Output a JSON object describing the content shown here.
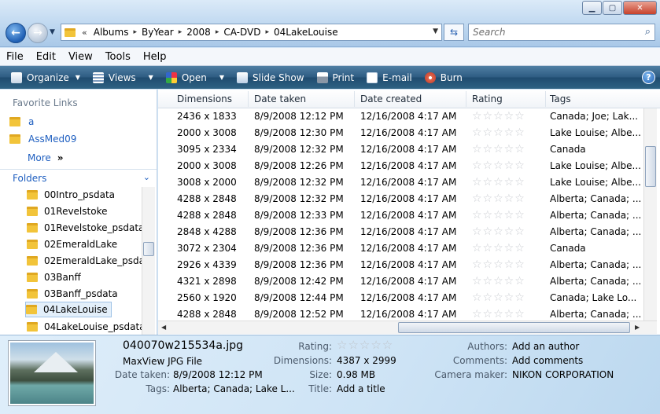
{
  "window": {
    "minimize_glyph": "▁",
    "maximize_glyph": "▢",
    "close_glyph": "✕"
  },
  "address": {
    "chevron": "«",
    "crumbs": [
      "Albums",
      "ByYear",
      "2008",
      "CA-DVD",
      "04LakeLouise"
    ]
  },
  "search": {
    "placeholder": "Search"
  },
  "menu": [
    "File",
    "Edit",
    "View",
    "Tools",
    "Help"
  ],
  "toolbar": {
    "organize": "Organize",
    "views": "Views",
    "open": "Open",
    "slideshow": "Slide Show",
    "print": "Print",
    "email": "E-mail",
    "burn": "Burn",
    "help": "?"
  },
  "left": {
    "favorite_links_title": "Favorite Links",
    "favorites": [
      "a",
      "AssMed09"
    ],
    "more_label": "More",
    "folders_title": "Folders",
    "folders": [
      "00Intro_psdata",
      "01Revelstoke",
      "01Revelstoke_psdata",
      "02EmeraldLake",
      "02EmeraldLake_psdata",
      "03Banff",
      "03Banff_psdata",
      "04LakeLouise",
      "04LakeLouise_psdata"
    ],
    "selected_folder": "04LakeLouise"
  },
  "columns": [
    "Dimensions",
    "Date taken",
    "Date created",
    "Rating",
    "Tags"
  ],
  "rows": [
    [
      "2436 x 1833",
      "8/9/2008 12:12 PM",
      "12/16/2008 4:17 AM",
      "Canada; Joe; Lak..."
    ],
    [
      "2000 x 3008",
      "8/9/2008 12:30 PM",
      "12/16/2008 4:17 AM",
      "Lake Louise; Albe..."
    ],
    [
      "3095 x 2334",
      "8/9/2008 12:32 PM",
      "12/16/2008 4:17 AM",
      "Canada"
    ],
    [
      "2000 x 3008",
      "8/9/2008 12:26 PM",
      "12/16/2008 4:17 AM",
      "Lake Louise; Albe..."
    ],
    [
      "3008 x 2000",
      "8/9/2008 12:32 PM",
      "12/16/2008 4:17 AM",
      "Lake Louise; Albe..."
    ],
    [
      "4288 x 2848",
      "8/9/2008 12:32 PM",
      "12/16/2008 4:17 AM",
      "Alberta; Canada; ..."
    ],
    [
      "4288 x 2848",
      "8/9/2008 12:33 PM",
      "12/16/2008 4:17 AM",
      "Alberta; Canada; ..."
    ],
    [
      "2848 x 4288",
      "8/9/2008 12:36 PM",
      "12/16/2008 4:17 AM",
      "Alberta; Canada; ..."
    ],
    [
      "3072 x 2304",
      "8/9/2008 12:36 PM",
      "12/16/2008 4:17 AM",
      "Canada"
    ],
    [
      "2926 x 4339",
      "8/9/2008 12:36 PM",
      "12/16/2008 4:17 AM",
      "Alberta; Canada; ..."
    ],
    [
      "4321 x 2898",
      "8/9/2008 12:42 PM",
      "12/16/2008 4:17 AM",
      "Alberta; Canada; ..."
    ],
    [
      "2560 x 1920",
      "8/9/2008 12:44 PM",
      "12/16/2008 4:17 AM",
      "Canada; Lake Lo..."
    ],
    [
      "4288 x 2848",
      "8/9/2008 12:52 PM",
      "12/16/2008 4:17 AM",
      "Alberta; Canada; ..."
    ]
  ],
  "rating_stars": "☆☆☆☆☆",
  "details": {
    "filename": "040070w215534a.jpg",
    "filetype": "MaxView JPG File",
    "date_taken_label": "Date taken:",
    "date_taken": "8/9/2008 12:12 PM",
    "tags_label": "Tags:",
    "tags": "Alberta; Canada; Lake L...",
    "rating_label": "Rating:",
    "rating_stars": "☆☆☆☆☆",
    "dimensions_label": "Dimensions:",
    "dimensions": "4387 x 2999",
    "size_label": "Size:",
    "size": "0.98 MB",
    "title_label": "Title:",
    "title": "Add a title",
    "authors_label": "Authors:",
    "authors": "Add an author",
    "comments_label": "Comments:",
    "comments": "Add comments",
    "camera_label": "Camera maker:",
    "camera": "NIKON CORPORATION"
  }
}
